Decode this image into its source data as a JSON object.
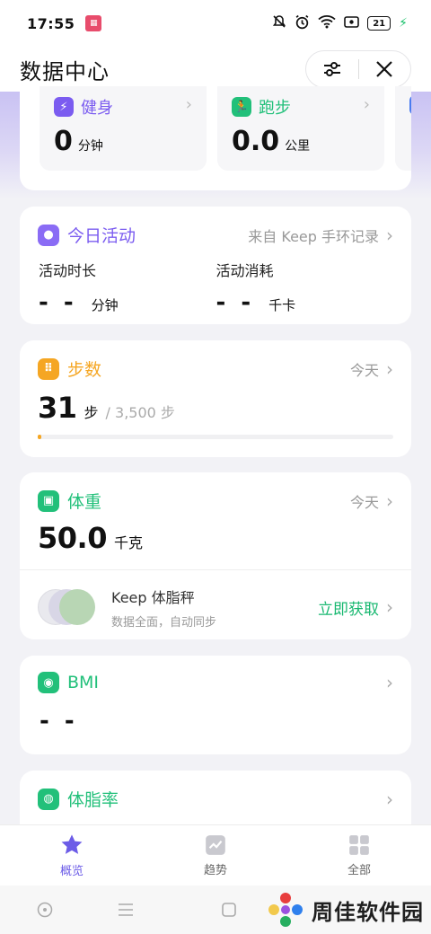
{
  "status_bar": {
    "time": "17:55",
    "battery": "21"
  },
  "header": {
    "title": "数据中心"
  },
  "sports": [
    {
      "label": "健身",
      "value": "0",
      "unit": "分钟",
      "color": "#7b5cf0"
    },
    {
      "label": "跑步",
      "value": "0.0",
      "unit": "公里",
      "color": "#22c07a"
    }
  ],
  "activity": {
    "title": "今日活动",
    "source": "来自 Keep 手环记录",
    "color": "#8a6cf5",
    "duration": {
      "label": "活动时长",
      "value": "- -",
      "unit": "分钟"
    },
    "calories": {
      "label": "活动消耗",
      "value": "- -",
      "unit": "千卡"
    }
  },
  "steps": {
    "title": "步数",
    "date": "今天",
    "value": "31",
    "unit": "步",
    "goal": "/ 3,500 步",
    "progress": 0.009,
    "color": "#f5a623"
  },
  "weight": {
    "title": "体重",
    "date": "今天",
    "value": "50.0",
    "unit": "千克",
    "color": "#22c07a",
    "scale": {
      "name": "Keep 体脂秤",
      "desc": "数据全面，自动同步",
      "action": "立即获取"
    }
  },
  "bmi": {
    "title": "BMI",
    "value": "- -",
    "color": "#22c07a"
  },
  "body_fat": {
    "title": "体脂率",
    "color": "#22c07a"
  },
  "bottom_nav": [
    {
      "label": "概览",
      "active": true
    },
    {
      "label": "趋势",
      "active": false
    },
    {
      "label": "全部",
      "active": false
    }
  ],
  "watermark": {
    "text": "周佳软件园"
  }
}
